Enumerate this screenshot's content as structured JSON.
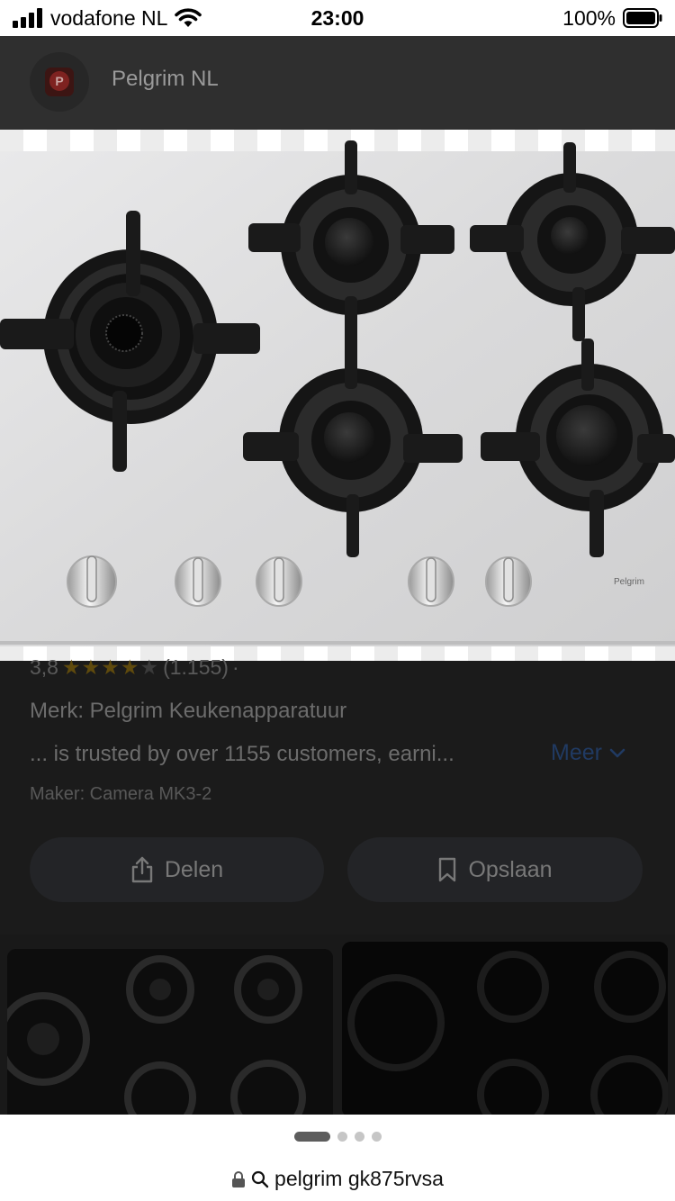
{
  "status_bar": {
    "carrier": "vodafone NL",
    "time": "23:00",
    "battery": "100%"
  },
  "header": {
    "favicon_letter": "P",
    "site_name": "Pelgrim NL"
  },
  "hero_image": {
    "brand_mark": "Pelgrim"
  },
  "details": {
    "rating_value": "3,8",
    "stars_full": "★★★★",
    "stars_empty": "★",
    "rating_count": "(1.155)",
    "rating_separator": "·",
    "merk": "Merk: Pelgrim Keukenapparatuur",
    "snippet": "... is trusted by over 1155 customers, earni...",
    "more_label": "Meer",
    "maker": "Maker: Camera MK3-2"
  },
  "actions": {
    "share_label": "Delen",
    "save_label": "Opslaan"
  },
  "browser": {
    "url_text": "pelgrim gk875rvsa"
  },
  "icons": {
    "signal": "signal-bars-icon",
    "wifi": "wifi-icon",
    "battery": "battery-icon",
    "share": "share-icon",
    "bookmark": "bookmark-icon",
    "chevron": "chevron-down-icon",
    "lock": "lock-icon",
    "search": "search-icon"
  },
  "colors": {
    "link": "#203a62",
    "star": "#5f4a0d",
    "overlay_bg": "#1b1b1b"
  }
}
